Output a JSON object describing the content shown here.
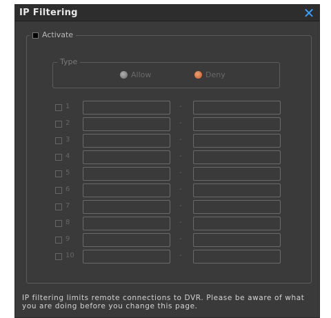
{
  "dialog": {
    "title": "IP Filtering",
    "close_glyph": "✕"
  },
  "activate": {
    "label": "Activate",
    "checked": false
  },
  "type": {
    "legend": "Type",
    "options": [
      {
        "label": "Allow",
        "selected": false
      },
      {
        "label": "Deny",
        "selected": true
      }
    ]
  },
  "ranges": [
    {
      "number": "1",
      "dash": "-",
      "start": "",
      "end": ""
    },
    {
      "number": "2",
      "dash": "-",
      "start": "",
      "end": ""
    },
    {
      "number": "3",
      "dash": "-",
      "start": "",
      "end": ""
    },
    {
      "number": "4",
      "dash": "-",
      "start": "",
      "end": ""
    },
    {
      "number": "5",
      "dash": "-",
      "start": "",
      "end": ""
    },
    {
      "number": "6",
      "dash": "-",
      "start": "",
      "end": ""
    },
    {
      "number": "7",
      "dash": "-",
      "start": "",
      "end": ""
    },
    {
      "number": "8",
      "dash": "-",
      "start": "",
      "end": ""
    },
    {
      "number": "9",
      "dash": "-",
      "start": "",
      "end": ""
    },
    {
      "number": "10",
      "dash": "-",
      "start": "",
      "end": ""
    }
  ],
  "footer": {
    "info_text": "IP filtering limits remote connections to DVR. Please be aware of what you are doing before you change this page."
  },
  "colors": {
    "background": "#3a3a3a",
    "title_bar": "#2d2d2d",
    "close_accent": "#3aa0ff",
    "deny_selected": "#c05a28"
  }
}
